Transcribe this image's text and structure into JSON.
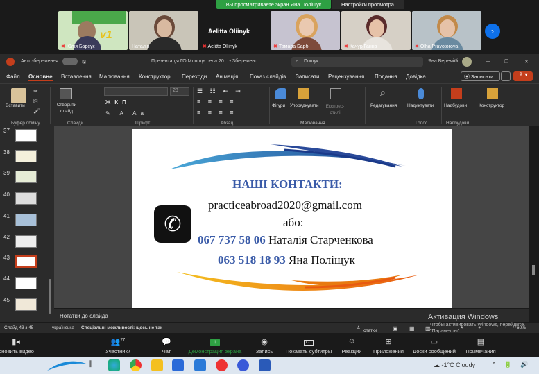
{
  "zoom": {
    "share_banner": "Вы просматриваете экран Яна Поліщук",
    "view_settings": "Настройки просмотра",
    "participants": [
      {
        "name": "Юлія Барсук"
      },
      {
        "name": "Наталія"
      },
      {
        "name": "Aelitta Oliinyk",
        "big_name": "Aelitta Oliinyk"
      },
      {
        "name": "Тамара Барб"
      },
      {
        "name": "Качур Ганна"
      },
      {
        "name": "Olha Pravotorova"
      }
    ],
    "tile_banner_text": "v1",
    "controls": [
      {
        "label": "оновить видео"
      },
      {
        "label": "Участники",
        "count": "77"
      },
      {
        "label": "Чат"
      },
      {
        "label": "Демонстрация экрана"
      },
      {
        "label": "Запись"
      },
      {
        "label": "Показать субтитры",
        "badge": "CC"
      },
      {
        "label": "Реакции"
      },
      {
        "label": "Приложения"
      },
      {
        "label": "Доски сообщений"
      },
      {
        "label": "Примечания"
      }
    ]
  },
  "ppt": {
    "autosave": "Автозбереження",
    "doc_title": "Презентація ГО Молодь села 20... • Збережено",
    "search": "Пошук",
    "user": "Яна Вереміїй",
    "tabs": [
      "Файл",
      "Основне",
      "Вставлення",
      "Малювання",
      "Конструктор",
      "Переходи",
      "Анімація",
      "Показ слайдів",
      "Записати",
      "Рецензування",
      "Подання",
      "Довідка"
    ],
    "record_btn": "Записати",
    "ribbon": {
      "paste": "Вставити",
      "new_slide": "Створити слайд",
      "font_size": "28",
      "shapes": "Фігури",
      "arrange": "Упорядкувати",
      "quick_styles": "Експрес-стилі",
      "editing": "Редагування",
      "dictate": "Надиктувати",
      "addins": "Надбудови",
      "designer": "Конструктор",
      "groups": [
        "Буфер обміну",
        "Слайди",
        "Шрифт",
        "Абзац",
        "Малювання",
        "Голос",
        "Надбудови"
      ]
    },
    "thumbs": [
      {
        "n": "37"
      },
      {
        "n": "38"
      },
      {
        "n": "39"
      },
      {
        "n": "40"
      },
      {
        "n": "41"
      },
      {
        "n": "42"
      },
      {
        "n": "43"
      },
      {
        "n": "44"
      },
      {
        "n": "45"
      }
    ],
    "notes_placeholder": "Нотатки до слайда",
    "status": {
      "slide": "Слайд 43 з 45",
      "lang": "українська",
      "accessibility": "Спеціальні можливості: щось не так",
      "notes": "Нотатки",
      "zoom": "60%"
    }
  },
  "slide": {
    "heading": "НАШІ КОНТАКТИ:",
    "email": "practiceabroad2020@gmail.com",
    "or": "або:",
    "phone1": "067 737 58 06",
    "name1": "Наталія Старченкова",
    "phone2": "063 518 18 93",
    "name2": "Яна Поліщук"
  },
  "watermark": {
    "line1": "Активация Windows",
    "line2": "Чтобы активировать Windows, перейдите",
    "line3": "\"Параметры\"."
  },
  "taskbar": {
    "weather": "-1°C  Cloudy"
  },
  "colors": {
    "accent_blue": "#3a5ba8",
    "share_green": "#2ea043",
    "zoom_blue": "#0e71eb",
    "ppt_red": "#c43e1c"
  }
}
